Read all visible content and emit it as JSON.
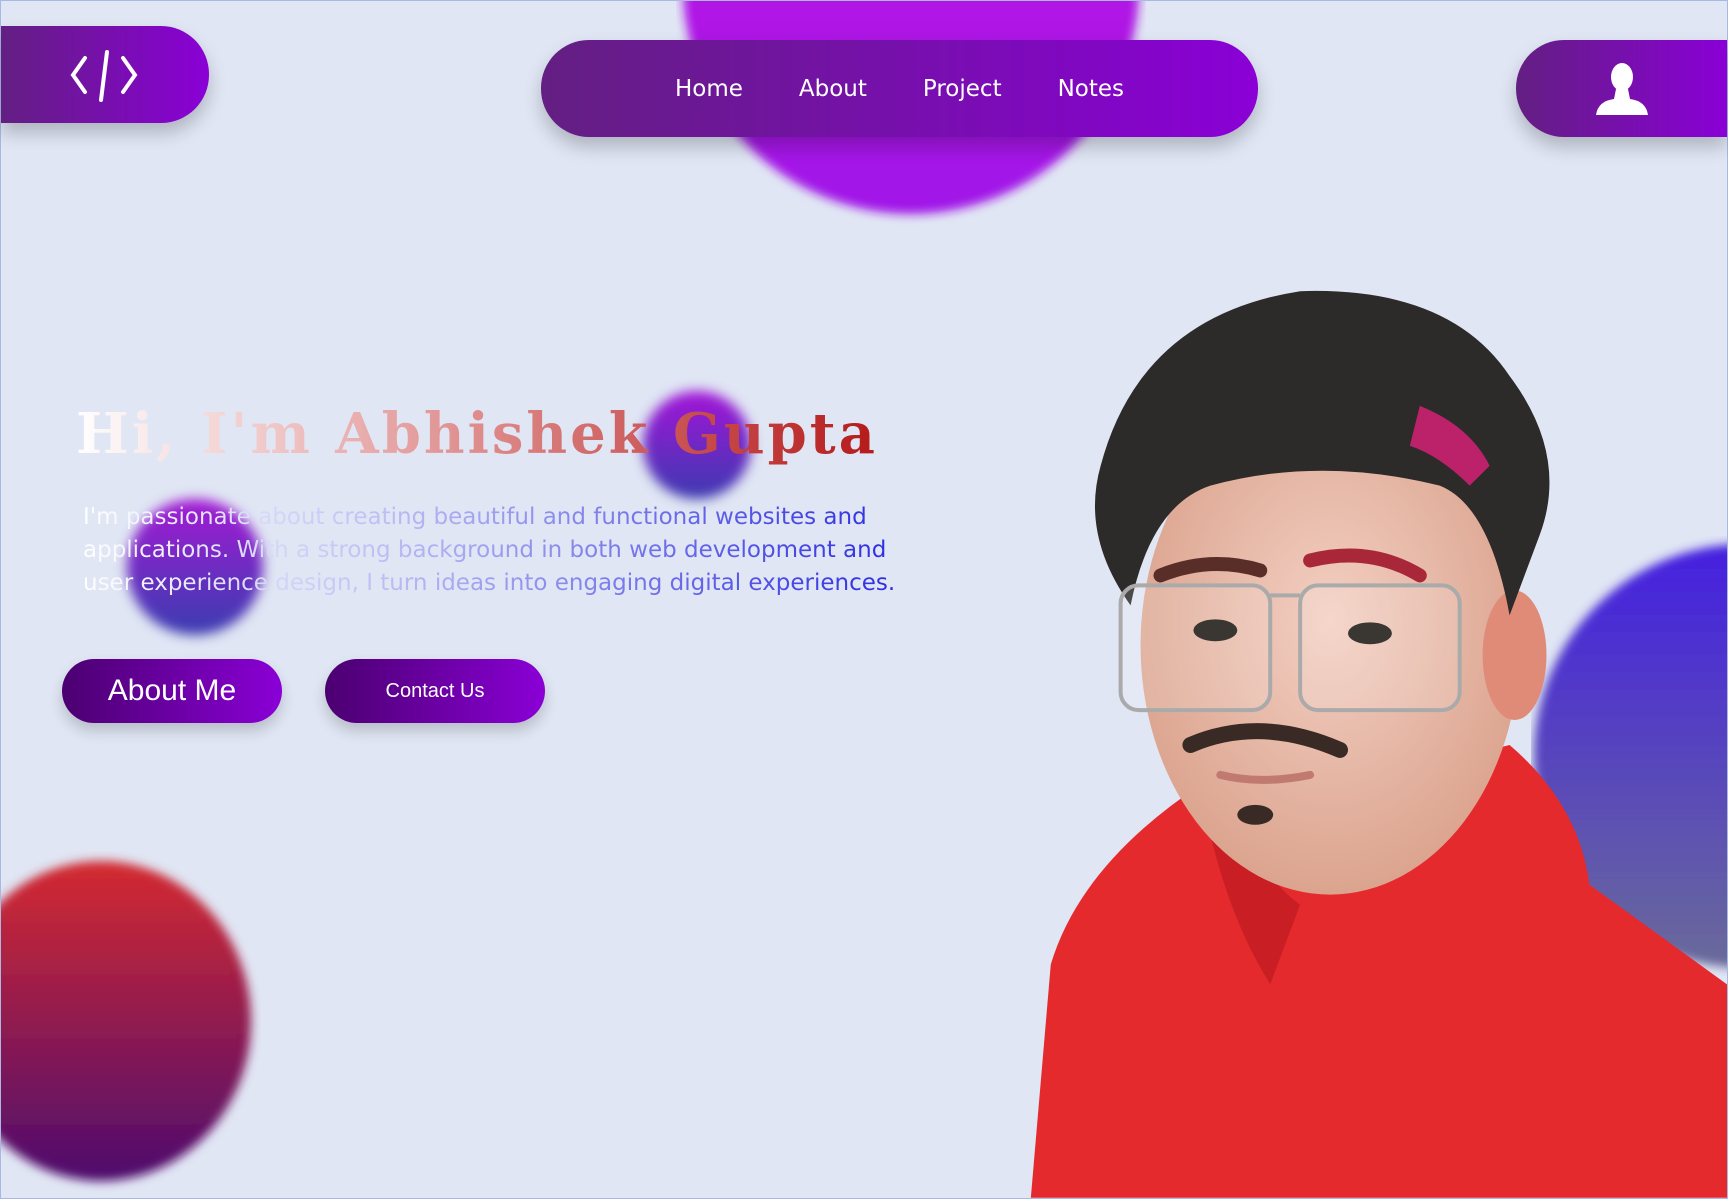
{
  "header": {
    "logo_icon": "code-brackets-icon",
    "nav": [
      {
        "label": "Home"
      },
      {
        "label": "About"
      },
      {
        "label": "Project"
      },
      {
        "label": "Notes"
      }
    ],
    "user_icon": "user-icon"
  },
  "hero": {
    "title": "Hi, I'm Abhishek Gupta",
    "description": "I'm passionate about creating beautiful and functional websites and applications. With a strong background in both web development and user experience design, I turn ideas into engaging digital experiences.",
    "buttons": {
      "about": "About Me",
      "contact": "Contact Us"
    }
  },
  "colors": {
    "background": "#e0e6f4",
    "accent_start": "#631f82",
    "accent_end": "#8a00d6",
    "title_gradient_end": "#b51a1a",
    "text_gradient_end": "#2a2ae0"
  }
}
